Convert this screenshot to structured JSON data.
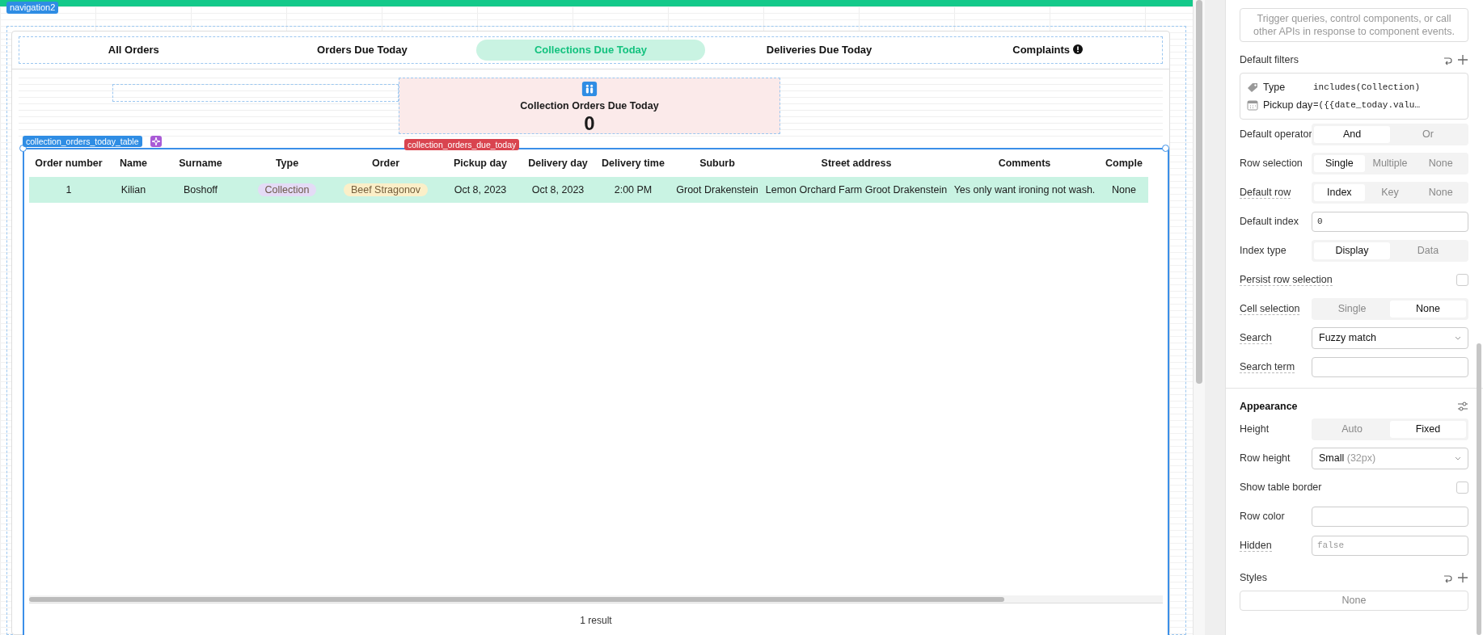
{
  "canvas": {
    "frame_tag": "navigation2",
    "tabs": [
      {
        "label": "All Orders",
        "selected": false,
        "alert": false
      },
      {
        "label": "Orders Due Today",
        "selected": false,
        "alert": false
      },
      {
        "label": "Collections Due Today",
        "selected": true,
        "alert": false
      },
      {
        "label": "Deliveries Due Today",
        "selected": false,
        "alert": false
      },
      {
        "label": "Complaints",
        "selected": false,
        "alert": true
      }
    ],
    "stat": {
      "title": "Collection Orders Due Today",
      "value": "0",
      "tag": "collection_orders_due_today"
    },
    "table": {
      "tag": "collection_orders_today_table",
      "columns": [
        "Order number",
        "Name",
        "Surname",
        "Type",
        "Order",
        "Pickup day",
        "Delivery day",
        "Delivery time",
        "Suburb",
        "Street address",
        "Comments",
        "Comple"
      ],
      "rows": [
        {
          "selected": true,
          "cells": [
            {
              "kind": "text",
              "text": "1"
            },
            {
              "kind": "text",
              "text": "Kilian"
            },
            {
              "kind": "text",
              "text": "Boshoff"
            },
            {
              "kind": "tag",
              "text": "Collection",
              "color": "#e4dbf6"
            },
            {
              "kind": "tag",
              "text": "Beef Stragonov",
              "color": "#fbefc8"
            },
            {
              "kind": "text",
              "text": "Oct 8, 2023"
            },
            {
              "kind": "text",
              "text": "Oct 8, 2023"
            },
            {
              "kind": "text",
              "text": "2:00 PM"
            },
            {
              "kind": "text",
              "text": "Groot Drakenstein"
            },
            {
              "kind": "text",
              "text": "Lemon Orchard Farm Groot Drakenstein"
            },
            {
              "kind": "text",
              "text": "Yes only want ironing not wash."
            },
            {
              "kind": "text",
              "text": "None"
            }
          ]
        }
      ],
      "footer": "1 result"
    }
  },
  "inspector": {
    "event_hint": "Trigger queries, control components, or call other APIs in response to component events.",
    "filters_title": "Default filters",
    "filters": [
      {
        "kind": "tag",
        "label": "Type",
        "value": "includes(Collection)"
      },
      {
        "kind": "calendar",
        "label": "Pickup day",
        "value": "=({{date_today.valu…"
      }
    ],
    "rows": [
      {
        "kind": "segmented",
        "label": "Default operator",
        "tooltip": false,
        "options": [
          {
            "label": "And",
            "selected": true
          },
          {
            "label": "Or",
            "selected": false
          }
        ]
      },
      {
        "kind": "segmented",
        "label": "Row selection",
        "tooltip": false,
        "options": [
          {
            "label": "Single",
            "selected": true
          },
          {
            "label": "Multiple",
            "selected": false
          },
          {
            "label": "None",
            "selected": false
          }
        ]
      },
      {
        "kind": "segmented",
        "label": "Default row",
        "tooltip": true,
        "options": [
          {
            "label": "Index",
            "selected": true
          },
          {
            "label": "Key",
            "selected": false
          },
          {
            "label": "None",
            "selected": false
          }
        ]
      },
      {
        "kind": "input",
        "label": "Default index",
        "tooltip": false,
        "value": "0"
      },
      {
        "kind": "segmented",
        "label": "Index type",
        "tooltip": false,
        "options": [
          {
            "label": "Display",
            "selected": true
          },
          {
            "label": "Data",
            "selected": false
          }
        ]
      },
      {
        "kind": "checkbox",
        "label": "Persist row selection",
        "tooltip": true,
        "checked": false
      },
      {
        "kind": "segmented",
        "label": "Cell selection",
        "tooltip": true,
        "options": [
          {
            "label": "Single",
            "selected": false
          },
          {
            "label": "None",
            "selected": true
          }
        ]
      },
      {
        "kind": "select",
        "label": "Search",
        "tooltip": true,
        "value": "Fuzzy match"
      },
      {
        "kind": "input",
        "label": "Search term",
        "tooltip": true
      }
    ],
    "appearance_title": "Appearance",
    "appearance_rows": [
      {
        "kind": "segmented",
        "label": "Height",
        "tooltip": false,
        "options": [
          {
            "label": "Auto",
            "selected": false
          },
          {
            "label": "Fixed",
            "selected": true
          }
        ]
      },
      {
        "kind": "select",
        "label": "Row height",
        "tooltip": false,
        "value": "Small",
        "hint": "(32px)"
      },
      {
        "kind": "checkbox",
        "label": "Show table border",
        "tooltip": false,
        "checked": false
      },
      {
        "kind": "input",
        "label": "Row color",
        "tooltip": false
      },
      {
        "kind": "input",
        "label": "Hidden",
        "tooltip": true,
        "placeholder": "false"
      }
    ],
    "styles_title": "Styles",
    "styles_value": "None"
  }
}
